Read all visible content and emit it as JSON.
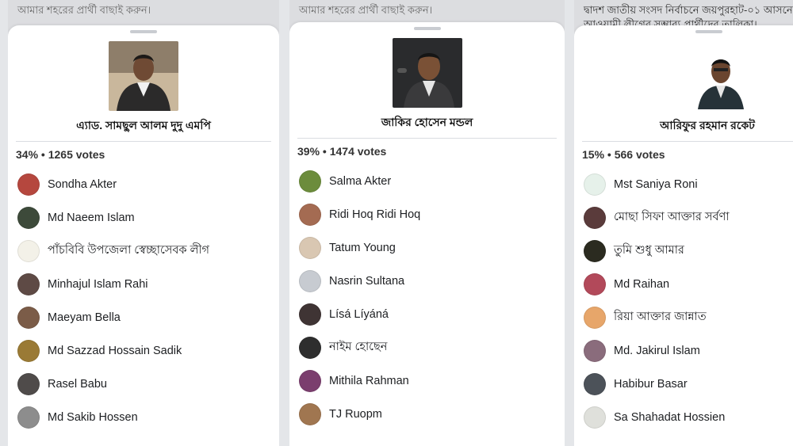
{
  "columns": [
    {
      "background_text": "আমার শহরের প্রার্থী বাছাই করুন।",
      "candidate_name": "এ্যাড. সামছুল আলম দুদু এমপি",
      "percent": "34%",
      "votes": "1265 votes",
      "voters": [
        {
          "name": "Sondha Akter",
          "color": "#b5473e"
        },
        {
          "name": "Md Naeem Islam",
          "color": "#3d4a3a"
        },
        {
          "name": "পাঁচবিবি উপজেলা স্বেচ্ছাসেবক লীগ",
          "color": "#f3f1e8"
        },
        {
          "name": "Minhajul Islam Rahi",
          "color": "#5e4a45"
        },
        {
          "name": "Maeyam Bella",
          "color": "#7b5c48"
        },
        {
          "name": "Md Sazzad Hossain Sadik",
          "color": "#9a7a35"
        },
        {
          "name": "Rasel Babu",
          "color": "#4f4b4a"
        },
        {
          "name": "Md Sakib Hossen",
          "color": "#8d8d8d"
        }
      ]
    },
    {
      "background_text": "আমার শহরের প্রার্থী বাছাই করুন।",
      "candidate_name": "জাকির হোসেন মন্ডল",
      "percent": "39%",
      "votes": "1474 votes",
      "voters": [
        {
          "name": "Salma Akter",
          "color": "#6c8c3c"
        },
        {
          "name": "Ridi Hoq Ridi Hoq",
          "color": "#a46b52"
        },
        {
          "name": "Tatum Young",
          "color": "#d9c7b2"
        },
        {
          "name": "Nasrin Sultana",
          "color": "#c7cbd1"
        },
        {
          "name": "Lísá Líyáná",
          "color": "#3f3434"
        },
        {
          "name": "নাইম হোছেন",
          "color": "#2e2e2e"
        },
        {
          "name": "Mithila Rahman",
          "color": "#7b3e6e"
        },
        {
          "name": "TJ Ruopm",
          "color": "#a07650"
        }
      ]
    },
    {
      "background_text_1": "দ্বাদশ জাতীয় সংসদ নির্বাচনে জয়পুরহাট-০১ আসনে",
      "background_text_2": "আওয়ামী লীগের সম্ভাব্য প্রার্থীদের তালিকা।",
      "candidate_name": "আরিফুর রহমান রকেট",
      "percent": "15%",
      "votes": "566 votes",
      "voters": [
        {
          "name": "Mst Saniya  Roni",
          "color": "#e6f1ea"
        },
        {
          "name": "মোছা সিফা আক্তার সর্বণা",
          "color": "#5a3b3b"
        },
        {
          "name": "তুমি শুধু আমার",
          "color": "#2b2b20"
        },
        {
          "name": "Md Raihan",
          "color": "#b2495a"
        },
        {
          "name": "রিয়া আক্তার জান্নাত",
          "color": "#e7a66a"
        },
        {
          "name": "Md. Jakirul Islam",
          "color": "#8a6c7c"
        },
        {
          "name": "Habibur Basar",
          "color": "#4c5259"
        },
        {
          "name": "Sa Shahadat Hossien",
          "color": "#dfe0db"
        }
      ]
    }
  ],
  "separator": " • "
}
